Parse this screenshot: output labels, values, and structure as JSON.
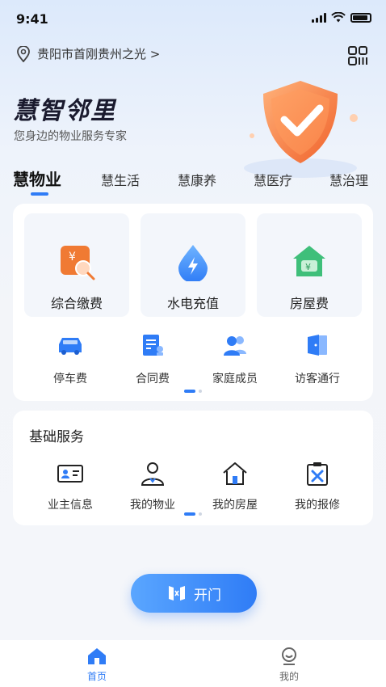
{
  "status_bar": {
    "time": "9:41"
  },
  "location": {
    "text": "贵阳市首刚贵州之光 >"
  },
  "brand": {
    "title": "慧智邻里",
    "subtitle": "您身边的物业服务专家"
  },
  "tabs": [
    {
      "label": "慧物业",
      "active": true
    },
    {
      "label": "慧生活"
    },
    {
      "label": "慧康养"
    },
    {
      "label": "慧医疗"
    },
    {
      "label": "慧治理"
    }
  ],
  "main_services": [
    {
      "label": "综合缴费",
      "icon": "payment-icon"
    },
    {
      "label": "水电充值",
      "icon": "water-electric-icon"
    },
    {
      "label": "房屋费",
      "icon": "house-fee-icon"
    }
  ],
  "sub_services": [
    {
      "label": "停车费",
      "icon": "car-icon"
    },
    {
      "label": "合同费",
      "icon": "contract-icon"
    },
    {
      "label": "家庭成员",
      "icon": "family-icon"
    },
    {
      "label": "访客通行",
      "icon": "door-icon"
    }
  ],
  "basic_services": {
    "title": "基础服务",
    "items": [
      {
        "label": "业主信息",
        "icon": "id-card-icon"
      },
      {
        "label": "我的物业",
        "icon": "staff-icon"
      },
      {
        "label": "我的房屋",
        "icon": "home-icon"
      },
      {
        "label": "我的报修",
        "icon": "repair-icon"
      }
    ]
  },
  "open_door": {
    "label": "开门"
  },
  "bottom_nav": [
    {
      "label": "首页",
      "active": true
    },
    {
      "label": "我的"
    }
  ],
  "colors": {
    "accent": "#2f7cf6",
    "orange": "#f07a33",
    "green": "#3fbf7a"
  }
}
